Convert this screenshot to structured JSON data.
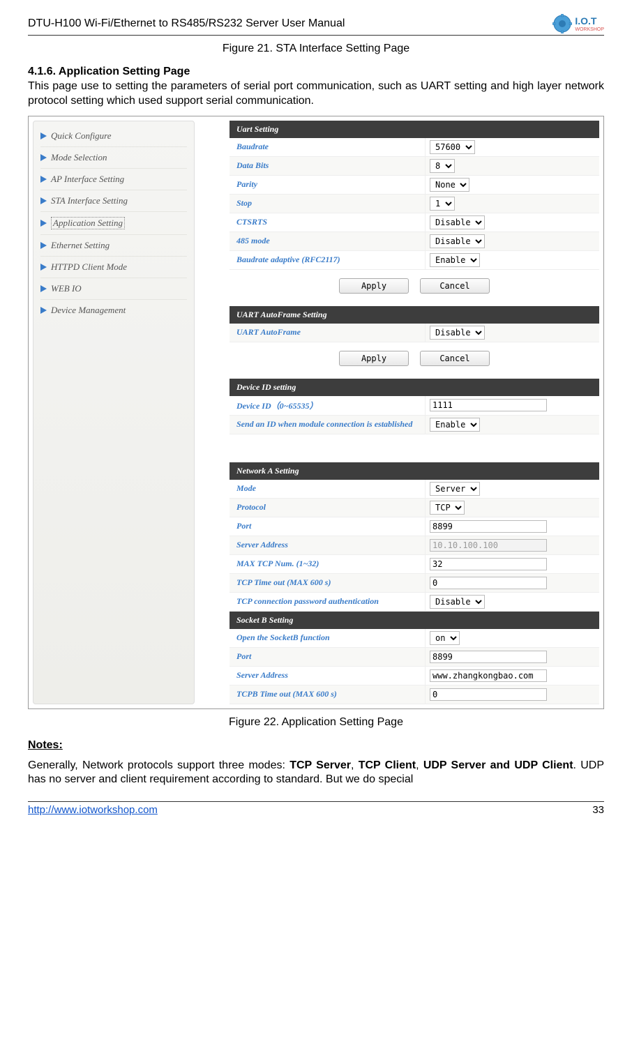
{
  "header": {
    "title": "DTU-H100  Wi-Fi/Ethernet to RS485/RS232  Server User Manual",
    "logo_main": "I.O.T",
    "logo_sub": "WORKSHOP"
  },
  "caption_top": "Figure 21.    STA Interface Setting Page",
  "section": {
    "number_title": "4.1.6.    Application Setting Page",
    "intro": "This page use to setting the parameters of serial port communication, such as UART setting and high layer network protocol setting which used support serial communication."
  },
  "sidebar": {
    "items": [
      "Quick Configure",
      "Mode Selection",
      "AP Interface Setting",
      "STA Interface Setting",
      "Application Setting",
      "Ethernet Setting",
      "HTTPD Client Mode",
      "WEB IO",
      "Device Management"
    ],
    "active_index": 4
  },
  "panels": {
    "uart": {
      "title": "Uart Setting",
      "rows": [
        {
          "label": "Baudrate",
          "type": "select",
          "value": "57600"
        },
        {
          "label": "Data Bits",
          "type": "select",
          "value": "8"
        },
        {
          "label": "Parity",
          "type": "select",
          "value": "None"
        },
        {
          "label": "Stop",
          "type": "select",
          "value": "1"
        },
        {
          "label": "CTSRTS",
          "type": "select",
          "value": "Disable"
        },
        {
          "label": "485 mode",
          "type": "select",
          "value": "Disable"
        },
        {
          "label": "Baudrate adaptive (RFC2117)",
          "type": "select",
          "value": "Enable"
        }
      ],
      "apply": "Apply",
      "cancel": "Cancel"
    },
    "autoframe": {
      "title": "UART AutoFrame Setting",
      "rows": [
        {
          "label": "UART AutoFrame",
          "type": "select",
          "value": "Disable"
        }
      ],
      "apply": "Apply",
      "cancel": "Cancel"
    },
    "deviceid": {
      "title": "Device ID setting",
      "rows": [
        {
          "label": "Device ID（0~65535）",
          "type": "input",
          "value": "1111"
        },
        {
          "label": "Send an ID when module connection is established",
          "type": "select",
          "value": "Enable"
        }
      ]
    },
    "networka": {
      "title": "Network A Setting",
      "rows": [
        {
          "label": "Mode",
          "type": "select",
          "value": "Server"
        },
        {
          "label": "Protocol",
          "type": "select",
          "value": "TCP"
        },
        {
          "label": "Port",
          "type": "input",
          "value": "8899"
        },
        {
          "label": "Server Address",
          "type": "input",
          "value": "10.10.100.100",
          "disabled": true
        },
        {
          "label": "MAX TCP Num. (1~32)",
          "type": "input",
          "value": "32"
        },
        {
          "label": "TCP Time out (MAX 600 s)",
          "type": "input",
          "value": "0"
        },
        {
          "label": "TCP connection password authentication",
          "type": "select",
          "value": "Disable"
        }
      ]
    },
    "socketb": {
      "title": "Socket B Setting",
      "rows": [
        {
          "label": "Open the SocketB function",
          "type": "select",
          "value": "on"
        },
        {
          "label": "Port",
          "type": "input",
          "value": "8899"
        },
        {
          "label": "Server Address",
          "type": "input",
          "value": "www.zhangkongbao.com"
        },
        {
          "label": "TCPB Time out (MAX 600 s)",
          "type": "input",
          "value": "0"
        }
      ]
    }
  },
  "caption_bottom": "Figure 22.    Application Setting Page",
  "notes": {
    "heading": "Notes:",
    "text_parts": {
      "p1": "Generally, Network protocols support three modes: ",
      "b1": "TCP Server",
      "p2": ", ",
      "b2": "TCP Client",
      "p3": ", ",
      "b3": "UDP Server and UDP Client",
      "p4": ". UDP has no server and client requirement according to standard. But we do special"
    }
  },
  "footer": {
    "url": "http://www.iotworkshop.com",
    "page": "33"
  }
}
